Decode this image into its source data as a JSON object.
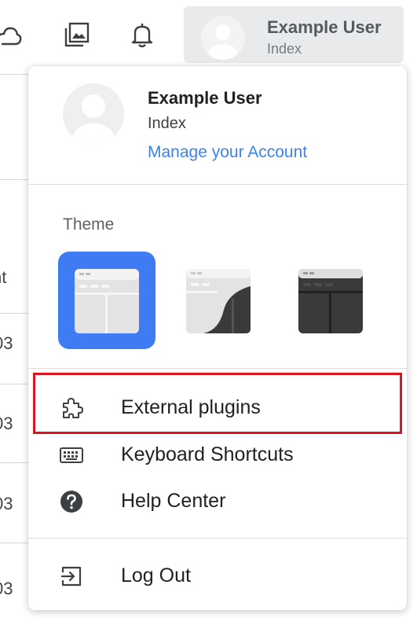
{
  "header": {
    "user_name": "Example User",
    "user_subtitle": "Index",
    "icons": [
      "cloud-icon",
      "image-gallery-icon",
      "bell-icon"
    ]
  },
  "background_table": {
    "column_fragment": "nt",
    "row_fragment": "03"
  },
  "menu": {
    "user_name": "Example User",
    "user_subtitle": "Index",
    "manage_account_link": "Manage your Account",
    "theme_label": "Theme",
    "themes": [
      {
        "name": "light",
        "selected": true
      },
      {
        "name": "auto",
        "selected": false
      },
      {
        "name": "dark",
        "selected": false
      }
    ],
    "items": [
      {
        "label": "External plugins",
        "icon": "puzzle-icon"
      },
      {
        "label": "Keyboard Shortcuts",
        "icon": "keyboard-icon"
      },
      {
        "label": "Help Center",
        "icon": "help-circle-icon"
      },
      {
        "label": "Log Out",
        "icon": "logout-icon"
      }
    ]
  },
  "colors": {
    "accent": "#3f7cf4",
    "link": "#3b82f6",
    "highlight": "#e0141e"
  }
}
